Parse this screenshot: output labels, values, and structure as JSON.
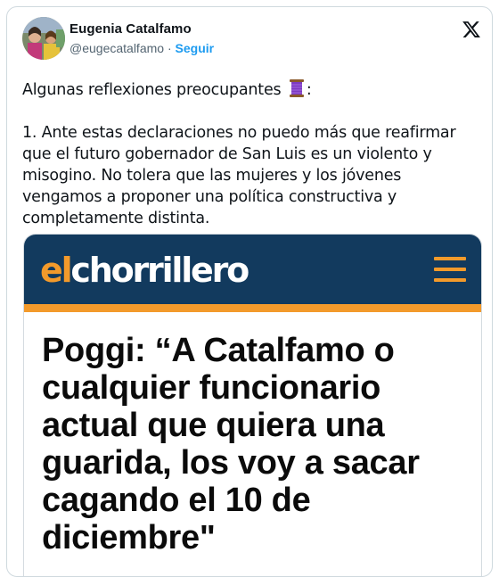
{
  "author": {
    "name": "Eugenia Catalfamo",
    "handle": "@eugecatalfamo",
    "separator": "·",
    "follow_label": "Seguir"
  },
  "icons": {
    "platform_logo": "x-logo-icon",
    "inline_emoji": "thread-spool-icon"
  },
  "tweet": {
    "intro": "Algunas reflexiones preocupantes",
    "intro_suffix": ":",
    "paragraph": "1. Ante estas declaraciones no puedo más que reafirmar que el futuro gobernador de San Luis es un violento y misogino. No tolera que las mujeres y los jóvenes vengamos a proponer una política constructiva y completamente distinta."
  },
  "media": {
    "logo_prefix": "el",
    "logo_rest": "chorrillero",
    "headline": "Poggi: “A Catalfamo o cualquier funcionario actual que quiera una guarida, los voy a sacar cagando el 10 de diciembre\""
  },
  "colors": {
    "brand_navy": "#123a5e",
    "brand_orange": "#f39a2b",
    "link_blue": "#1d9bf0",
    "text_dark": "#0f1419",
    "text_muted": "#536471"
  }
}
